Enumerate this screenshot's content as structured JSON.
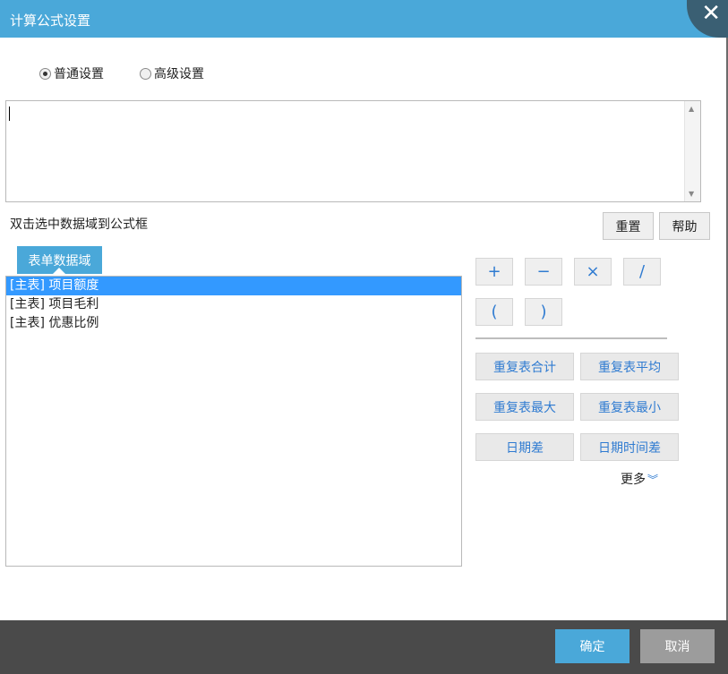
{
  "dialog": {
    "title": "计算公式设置",
    "close_glyph": "✕"
  },
  "mode": {
    "options": [
      {
        "label": "普通设置",
        "selected": true
      },
      {
        "label": "高级设置",
        "selected": false
      }
    ]
  },
  "formula": {
    "value": ""
  },
  "hint": "双击选中数据域到公式框",
  "actions": {
    "reset_label": "重置",
    "help_label": "帮助"
  },
  "fields_tab": "表单数据域",
  "fields": [
    {
      "label": "[主表] 项目额度",
      "selected": true
    },
    {
      "label": "[主表] 项目毛利",
      "selected": false
    },
    {
      "label": "[主表] 优惠比例",
      "selected": false
    }
  ],
  "operators": [
    "+",
    "−",
    "×",
    "/",
    "(",
    ")"
  ],
  "functions": [
    "重复表合计",
    "重复表平均",
    "重复表最大",
    "重复表最小",
    "日期差",
    "日期时间差"
  ],
  "more_label": "更多",
  "footer": {
    "ok_label": "确定",
    "cancel_label": "取消"
  },
  "colors": {
    "accent": "#4aa8d9",
    "selection": "#3399ff",
    "footer": "#4a4a4a"
  }
}
